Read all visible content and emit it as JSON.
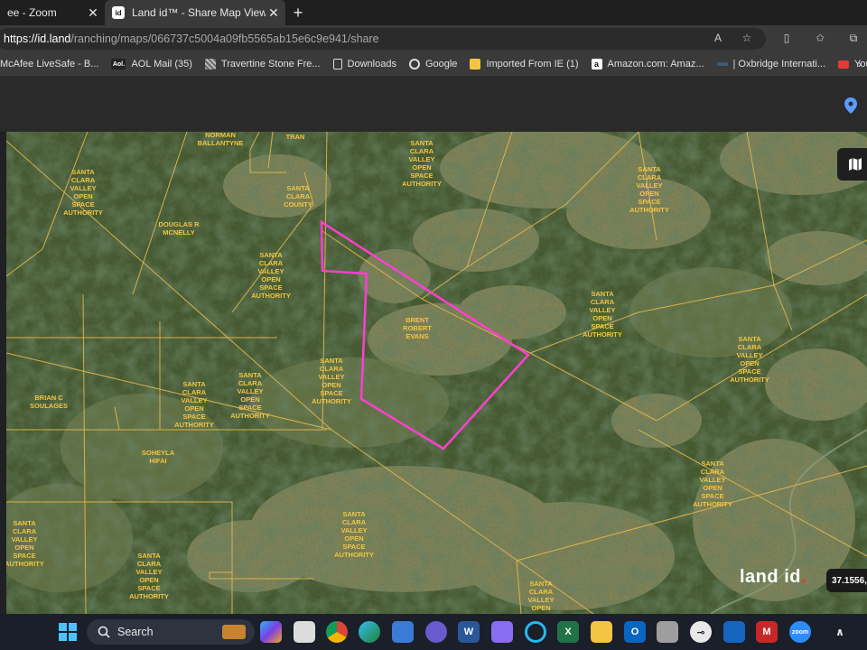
{
  "browser": {
    "tabs": [
      {
        "title": "ee - Zoom",
        "active": false,
        "favicon": "zoom-icon"
      },
      {
        "title": "Land id™ - Share Map View - Bra",
        "active": true,
        "favicon": "landid-icon",
        "favicon_text": "id"
      }
    ],
    "address": {
      "url_host": "https://id.land",
      "url_path": "/ranching/maps/066737c5004a09fb5565ab15e6c9e941/share"
    },
    "bookmarks": [
      {
        "label": "McAfee LiveSafe - B...",
        "icon": "mcafee-icon",
        "color": "#c62828"
      },
      {
        "label": "AOL Mail (35)",
        "icon": "aol-icon",
        "color": "#ffffff"
      },
      {
        "label": "Travertine Stone Fre...",
        "icon": "stone-icon",
        "color": "#9e9e9e"
      },
      {
        "label": "Downloads",
        "icon": "file-icon",
        "color": "#ffffff"
      },
      {
        "label": "Google",
        "icon": "google-icon",
        "color": "#ffffff"
      },
      {
        "label": "Imported From IE (1)",
        "icon": "folder-icon",
        "color": "#f4c542"
      },
      {
        "label": "Amazon.com: Amaz...",
        "icon": "amazon-icon",
        "color": "#ffffff"
      },
      {
        "label": "| Oxbridge Internati...",
        "icon": "oxbridge-icon",
        "color": "#3b5d7a"
      },
      {
        "label": "YouTube",
        "icon": "youtube-icon",
        "color": "#e53935"
      }
    ]
  },
  "map": {
    "labels": [
      {
        "lines": [
          "NORMAN",
          "BALLANTYNE"
        ]
      },
      {
        "lines": [
          "TRAN"
        ]
      },
      {
        "lines": [
          "SANTA",
          "CLARA",
          "COUNTY"
        ]
      },
      {
        "lines": [
          "SANTA",
          "CLARA",
          "VALLEY",
          "OPEN",
          "SPACE",
          "AUTHORITY"
        ]
      },
      {
        "lines": [
          "DOUGLAS R",
          "MCNELLY"
        ]
      },
      {
        "lines": [
          "SANTA",
          "CLARA",
          "VALLEY",
          "OPEN",
          "SPACE",
          "AUTHORITY"
        ]
      },
      {
        "lines": [
          "SANTA",
          "CLARA",
          "VALLEY",
          "OPEN",
          "SPACE",
          "AUTHORITY"
        ]
      },
      {
        "lines": [
          "SANTA",
          "CLARA",
          "VALLEY",
          "OPEN",
          "SPACE",
          "AUTHORITY"
        ]
      },
      {
        "lines": [
          "BRENT",
          "ROBERT",
          "EVANS"
        ]
      },
      {
        "lines": [
          "SANTA",
          "CLARA",
          "VALLEY",
          "OPEN",
          "SPACE",
          "AUTHORITY"
        ]
      },
      {
        "lines": [
          "SANTA",
          "CLARA",
          "VALLEY",
          "OPEN",
          "SPACE",
          "AUTHORITY"
        ]
      },
      {
        "lines": [
          "SANTA",
          "CLARA",
          "VALLEY",
          "OPEN",
          "SPACE",
          "AUTHORITY"
        ]
      },
      {
        "lines": [
          "SANTA",
          "CLARA",
          "VALLEY",
          "OPEN",
          "SPACE",
          "AUTHORITY"
        ]
      },
      {
        "lines": [
          "BRIAN C",
          "SOULAGES"
        ]
      },
      {
        "lines": [
          "SOHEYLA",
          "HIFAI"
        ]
      },
      {
        "lines": [
          "SANTA",
          "CLARA",
          "VALLEY",
          "OPEN",
          "SPACE",
          "AUTHORITY"
        ]
      },
      {
        "lines": [
          "SANTA",
          "CLARA",
          "VALLEY",
          "OPEN",
          "SPACE",
          "AUTHORITY"
        ]
      },
      {
        "lines": [
          "SANTA",
          "CLARA",
          "VALLEY",
          "OPEN",
          "SPACE",
          "AUTHORITY"
        ]
      },
      {
        "lines": [
          "SANTA",
          "CLARA",
          "VALLEY",
          "OPEN",
          "SPACE",
          "AUTHORITY"
        ]
      },
      {
        "lines": [
          "SANTA",
          "CLARA",
          "VALLEY",
          "OPEN",
          "SPACE",
          "AUTHORITY"
        ]
      },
      {
        "lines": [
          "SANTA",
          "CLARA",
          "VALLEY",
          "OPEN"
        ]
      }
    ],
    "logo_text": "land",
    "logo_text2": "id",
    "logo_dot": ".",
    "coordinates": "37.1556,",
    "colors": {
      "parcel_line": "#e8b84a",
      "selection": "#ff3fd0",
      "label": "#f5c542"
    }
  },
  "taskbar": {
    "search_label": "Search",
    "apps": [
      "windows-start-icon",
      "search-icon",
      "widgets-icon",
      "copilot-icon",
      "task-view-icon",
      "chrome-icon",
      "edge-icon",
      "store-icon",
      "quicken-icon",
      "word-icon",
      "app-icon",
      "alexa-icon",
      "excel-icon",
      "file-explorer-icon",
      "outlook-icon",
      "printer-icon",
      "key-icon",
      "vpn-icon",
      "mcafee-icon",
      "zoom-icon",
      "chevron-up-icon"
    ]
  }
}
